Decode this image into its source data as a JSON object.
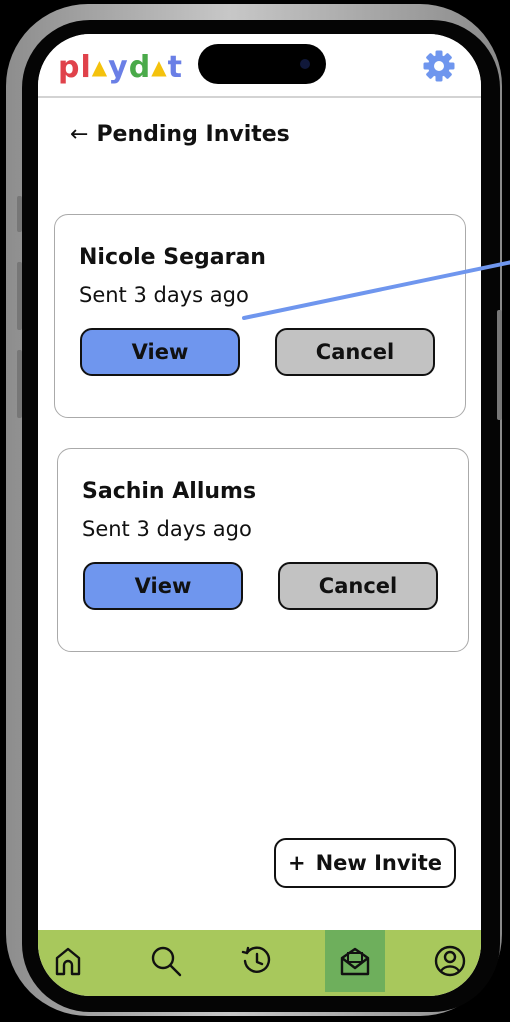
{
  "app": {
    "logo_letters": [
      "p",
      "l",
      "▲",
      "y",
      "d",
      "▲",
      "t"
    ],
    "logo_colors": [
      "#e0424b",
      "#e0424b",
      "#f4c20d",
      "#6a7fe6",
      "#4aaa4a",
      "#f4c20d",
      "#6a7fe6"
    ]
  },
  "header": {
    "settings_icon": "gear-icon",
    "accent": "#6f96ee"
  },
  "page": {
    "back_arrow": "←",
    "title": "Pending Invites"
  },
  "invites": [
    {
      "name": "Nicole Segaran",
      "sent": "Sent 3 days ago",
      "view_label": "View",
      "cancel_label": "Cancel"
    },
    {
      "name": "Sachin Allums",
      "sent": "Sent 3 days ago",
      "view_label": "View",
      "cancel_label": "Cancel"
    }
  ],
  "actions": {
    "new_invite_plus": "+",
    "new_invite_label": "New Invite"
  },
  "nav": {
    "items": [
      "home-icon",
      "search-icon",
      "history-icon",
      "inbox-icon",
      "profile-icon"
    ],
    "active": "inbox-icon",
    "bar_color": "#a8c85c",
    "active_color": "#6eaf5c"
  }
}
